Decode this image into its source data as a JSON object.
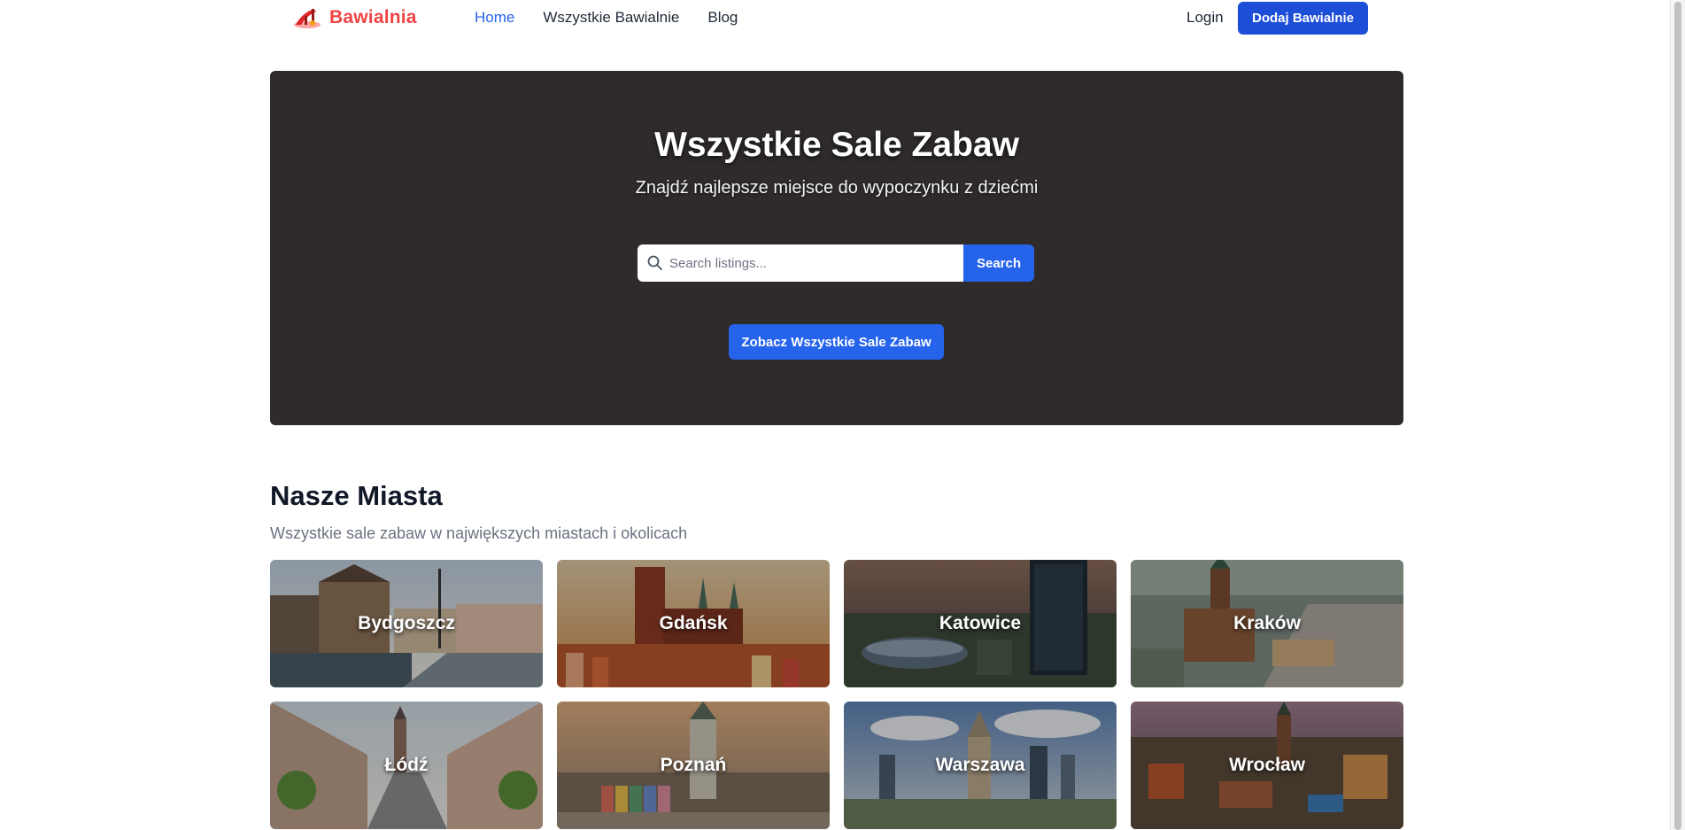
{
  "header": {
    "logo_text": "Bawialnia",
    "nav": [
      {
        "label": "Home",
        "active": true
      },
      {
        "label": "Wszystkie Bawialnie",
        "active": false
      },
      {
        "label": "Blog",
        "active": false
      }
    ],
    "login_label": "Login",
    "add_button_label": "Dodaj Bawialnie"
  },
  "hero": {
    "title": "Wszystkie Sale Zabaw",
    "subtitle": "Znajdź najlepsze miejsce do wypoczynku z dziećmi",
    "search_placeholder": "Search listings...",
    "search_button_label": "Search",
    "cta_label": "Zobacz Wszystkie Sale Zabaw"
  },
  "cities_section": {
    "title": "Nasze Miasta",
    "subtitle": "Wszystkie sale zabaw w największych miastach i okolicach",
    "cities": [
      {
        "name": "Bydgoszcz"
      },
      {
        "name": "Gdańsk"
      },
      {
        "name": "Katowice"
      },
      {
        "name": "Kraków"
      },
      {
        "name": "Łódź"
      },
      {
        "name": "Poznań"
      },
      {
        "name": "Warszawa"
      },
      {
        "name": "Wrocław"
      }
    ]
  },
  "colors": {
    "brand": "#ef4444",
    "accent": "#2563eb",
    "hero_bg": "#2f2b2b"
  }
}
